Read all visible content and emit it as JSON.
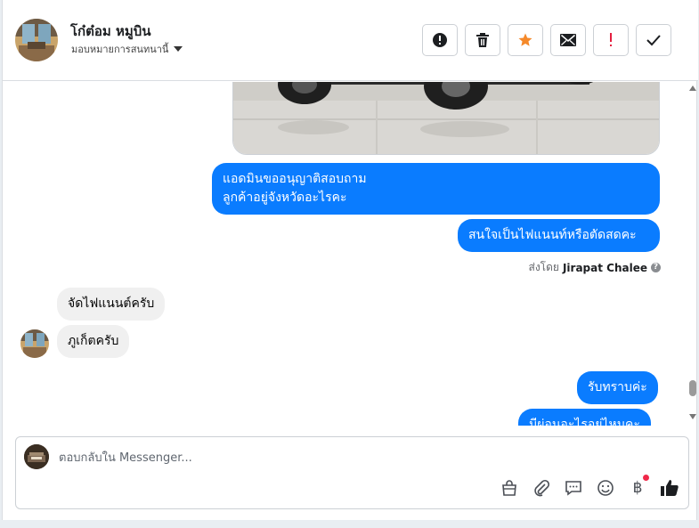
{
  "header": {
    "contact_name": "โก๋ต๋อม หมูบิน",
    "assign_label": "มอบหมายการสนทนานี้",
    "actions": [
      {
        "name": "spam-button",
        "icon": "exclamation-circle-icon"
      },
      {
        "name": "delete-button",
        "icon": "trash-icon"
      },
      {
        "name": "star-button",
        "icon": "star-icon"
      },
      {
        "name": "mark-unread-button",
        "icon": "envelope-icon"
      },
      {
        "name": "follow-up-button",
        "icon": "exclamation-icon"
      },
      {
        "name": "mark-done-button",
        "icon": "check-icon"
      }
    ]
  },
  "messages": {
    "out_1_line1": "แอดมินขออนุญาติสอบถาม",
    "out_1_line2": "ลูกค้าอยู่จังหวัดอะไรคะ",
    "out_2": "สนใจเป็นไฟแนนท์หรือตัดสดคะ",
    "sent_by_prefix": "ส่งโดย",
    "sent_by_name": "Jirapat Chalee",
    "in_1": "จัดไฟแนนต์ครับ",
    "in_2": "ภูเก็ตครับ",
    "out_3": "รับทราบค่ะ",
    "out_4": "มีผ่อนอะไรอยู่ไหมคะ"
  },
  "composer": {
    "placeholder": "ตอบกลับใน Messenger...",
    "value": "",
    "currency_symbol": "฿"
  },
  "colors": {
    "outgoing_bubble": "#0a7cff",
    "incoming_bubble": "#f0f0f0",
    "star_accent": "#f5892a",
    "alert_red": "#e41e3f",
    "notification_dot": "#f02849"
  }
}
